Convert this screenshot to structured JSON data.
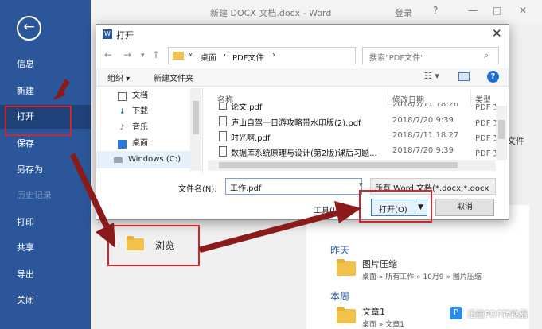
{
  "window": {
    "title": "新建 DOCX 文档.docx - Word",
    "login": "登录",
    "help": "?",
    "controls": [
      "—",
      "□",
      "✕"
    ]
  },
  "sidebar": {
    "back": "←",
    "items": [
      {
        "label": "信息"
      },
      {
        "label": "新建"
      },
      {
        "label": "打开"
      },
      {
        "label": "保存"
      },
      {
        "label": "另存为"
      },
      {
        "label": "历史记录"
      },
      {
        "label": "打印"
      },
      {
        "label": "共享"
      },
      {
        "label": "导出"
      },
      {
        "label": "关闭"
      }
    ]
  },
  "backstage": {
    "browse_label": "浏览",
    "overflow_text": "文件",
    "recent": [
      {
        "group": "昨天",
        "name": "图片压缩",
        "path": "桌面 » 所有工作 » 10月9 » 图片压缩"
      },
      {
        "group": "本周",
        "name": "文章1",
        "path": "桌面 » 文章1"
      }
    ]
  },
  "dialog": {
    "title": "打开",
    "close": "✕",
    "address": {
      "prefix": "«",
      "crumbs": [
        "桌面",
        "PDF文件"
      ],
      "sep": "›"
    },
    "search_placeholder": "搜索\"PDF文件\"",
    "toolbar": {
      "organize": "组织 ▾",
      "new_folder": "新建文件夹",
      "help": "?"
    },
    "nav_pane": [
      {
        "label": "文档",
        "icon": "document-icon"
      },
      {
        "label": "下载",
        "icon": "download-icon"
      },
      {
        "label": "音乐",
        "icon": "music-icon"
      },
      {
        "label": "桌面",
        "icon": "desktop-icon"
      },
      {
        "label": "Windows (C:)",
        "icon": "drive-icon"
      }
    ],
    "columns": {
      "name": "名称",
      "modified": "修改日期",
      "type": "类型"
    },
    "files": [
      {
        "name": "论文.pdf",
        "modified": "2018/7/11 18:26",
        "type": "PDF 文"
      },
      {
        "name": "庐山自驾一日游攻略带水印版(2).pdf",
        "modified": "2018/7/20 9:39",
        "type": "PDF 文"
      },
      {
        "name": "时光啊.pdf",
        "modified": "2018/7/11 18:27",
        "type": "PDF 文"
      },
      {
        "name": "数据库系统原理与设计(第2版)课后习题...",
        "modified": "2018/7/20 9:39",
        "type": "PDF 文"
      }
    ],
    "filename_label": "文件名(N):",
    "filename_value": "工作.pdf",
    "filetype_value": "所有 Word 文档(*.docx;*.docx",
    "tools_label": "工具(L)",
    "open_label": "打开(O)",
    "cancel_label": "取消"
  },
  "watermark": {
    "text": "迅捷PDF转换器"
  },
  "colors": {
    "sidebar": "#2b579a",
    "annotation": "#d2262b",
    "accent": "#3c7fd8"
  }
}
